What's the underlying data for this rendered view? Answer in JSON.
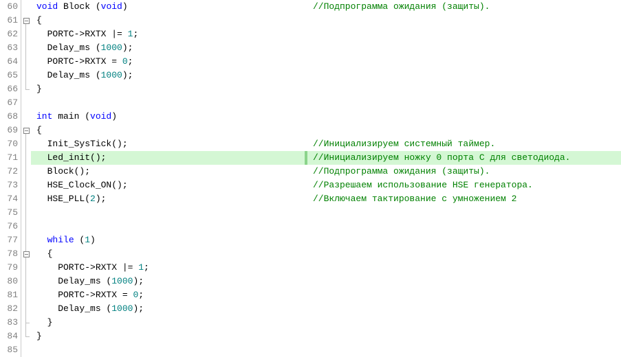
{
  "lines": [
    {
      "n": 60,
      "fold": "",
      "code": "<span class='kw'>void</span> Block (<span class='kw'>void</span>)",
      "comment": "//Подпрограмма ожидания (защиты)."
    },
    {
      "n": 61,
      "fold": "box",
      "code": "{",
      "comment": ""
    },
    {
      "n": 62,
      "fold": "line",
      "code": "  PORTC-&gt;RXTX |= <span class='num'>1</span>;",
      "comment": ""
    },
    {
      "n": 63,
      "fold": "line",
      "code": "  Delay_ms (<span class='num'>1000</span>);",
      "comment": ""
    },
    {
      "n": 64,
      "fold": "line",
      "code": "  PORTC-&gt;RXTX = <span class='num'>0</span>;",
      "comment": ""
    },
    {
      "n": 65,
      "fold": "line",
      "code": "  Delay_ms (<span class='num'>1000</span>);",
      "comment": ""
    },
    {
      "n": 66,
      "fold": "corner",
      "code": "}",
      "comment": ""
    },
    {
      "n": 67,
      "fold": "",
      "code": "",
      "comment": ""
    },
    {
      "n": 68,
      "fold": "",
      "code": "<span class='kw'>int</span> main (<span class='kw'>void</span>)",
      "comment": ""
    },
    {
      "n": 69,
      "fold": "box",
      "code": "{",
      "comment": ""
    },
    {
      "n": 70,
      "fold": "line",
      "code": "  Init_SysTick();",
      "comment": "//Инициализируем системный таймер."
    },
    {
      "n": 71,
      "fold": "line",
      "code": "  Led_init();",
      "comment": "//Инициализируем ножку 0 порта C для светодиода.",
      "hl": true
    },
    {
      "n": 72,
      "fold": "line",
      "code": "  Block();",
      "comment": "//Подпрограмма ожидания (защиты)."
    },
    {
      "n": 73,
      "fold": "line",
      "code": "  HSE_Clock_ON();",
      "comment": "//Разрешаем использование HSE генератора."
    },
    {
      "n": 74,
      "fold": "line",
      "code": "  HSE_PLL(<span class='num'>2</span>);",
      "comment": "//Включаем тактирование с умножением 2"
    },
    {
      "n": 75,
      "fold": "line",
      "code": "",
      "comment": ""
    },
    {
      "n": 76,
      "fold": "line",
      "code": "",
      "comment": ""
    },
    {
      "n": 77,
      "fold": "line",
      "code": "  <span class='kw'>while</span> (<span class='num'>1</span>)",
      "comment": ""
    },
    {
      "n": 78,
      "fold": "box-in",
      "code": "  {",
      "comment": ""
    },
    {
      "n": 79,
      "fold": "line",
      "code": "    PORTC-&gt;RXTX |= <span class='num'>1</span>;",
      "comment": ""
    },
    {
      "n": 80,
      "fold": "line",
      "code": "    Delay_ms (<span class='num'>1000</span>);",
      "comment": ""
    },
    {
      "n": 81,
      "fold": "line",
      "code": "    PORTC-&gt;RXTX = <span class='num'>0</span>;",
      "comment": ""
    },
    {
      "n": 82,
      "fold": "line",
      "code": "    Delay_ms (<span class='num'>1000</span>);",
      "comment": ""
    },
    {
      "n": 83,
      "fold": "corner-in",
      "code": "  }",
      "comment": ""
    },
    {
      "n": 84,
      "fold": "corner",
      "code": "}",
      "comment": ""
    },
    {
      "n": 85,
      "fold": "",
      "code": "",
      "comment": ""
    }
  ]
}
